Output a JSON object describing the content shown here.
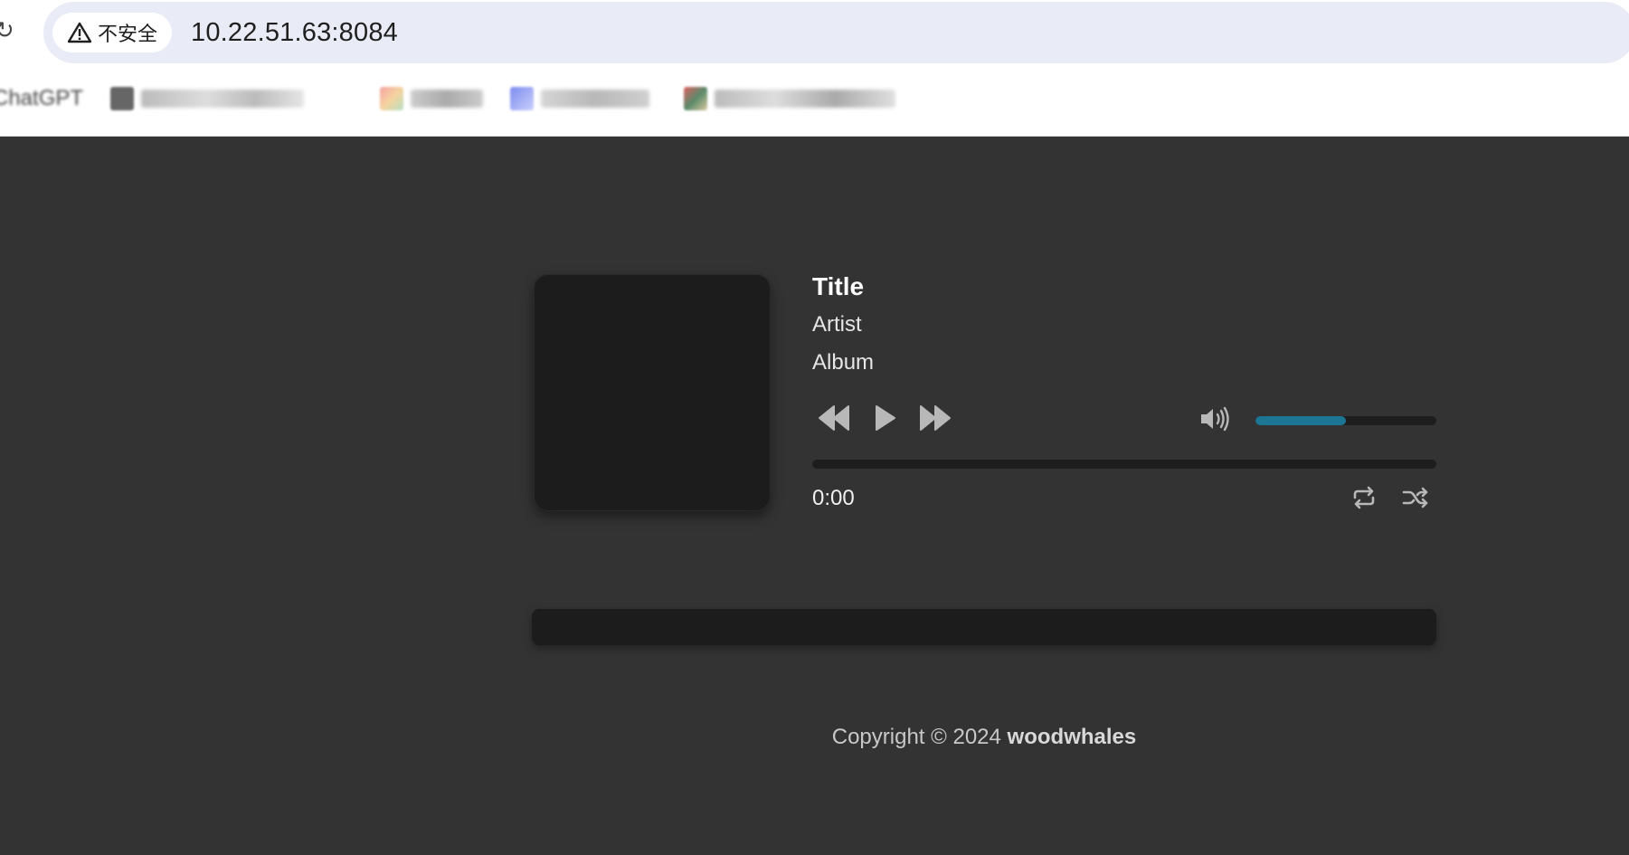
{
  "browser": {
    "security_label": "不安全",
    "url": "10.22.51.63:8084",
    "bookmarks": [
      {
        "label": "ChatGPT"
      }
    ]
  },
  "player": {
    "title": "Title",
    "artist": "Artist",
    "album": "Album",
    "current_time": "0:00",
    "volume_fraction": 0.5,
    "progress_fraction": 0.0,
    "accent_color": "#1b7593",
    "controls": {
      "rewind": "rewind-icon",
      "play": "play-icon",
      "fast_forward": "fast-forward-icon",
      "volume": "volume-icon",
      "repeat": "repeat-icon",
      "shuffle": "shuffle-icon"
    }
  },
  "footer": {
    "copyright": "Copyright © 2024",
    "author": "woodwhales"
  }
}
